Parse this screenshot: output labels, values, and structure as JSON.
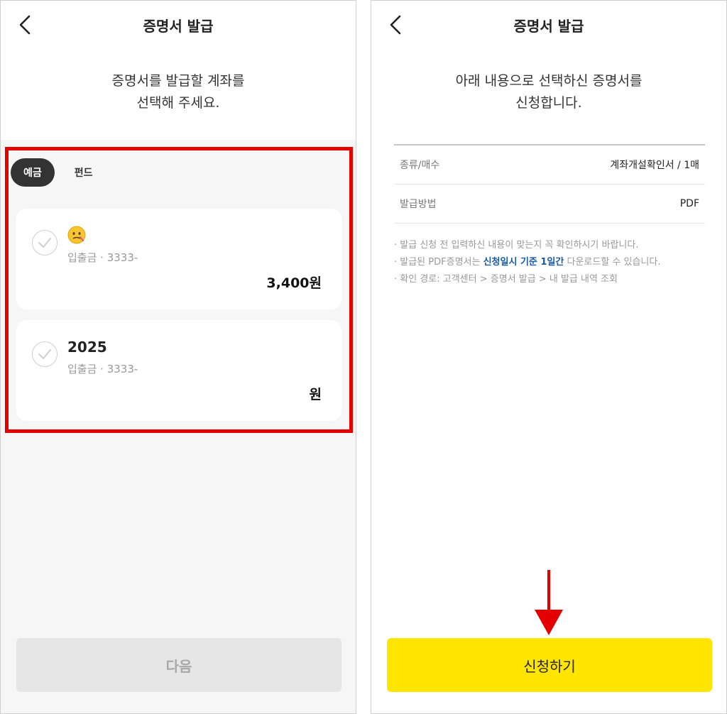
{
  "left": {
    "header": {
      "title": "증명서 발급"
    },
    "intro": {
      "line1": "증명서를 발급할 계좌를",
      "line2": "선택해 주세요."
    },
    "tabs": [
      {
        "label": "예금",
        "active": true
      },
      {
        "label": "펀드",
        "active": false
      }
    ],
    "accounts": [
      {
        "icon": "face-emoji-icon",
        "name": "",
        "type": "입출금 · 3333-",
        "amount": "3,400원"
      },
      {
        "name": "2025",
        "type": "입출금 · 3333-",
        "amount": "원"
      }
    ],
    "next_label": "다음",
    "highlight_color": "#e50000"
  },
  "right": {
    "header": {
      "title": "증명서 발급"
    },
    "intro": {
      "line1": "아래 내용으로 선택하신 증명서를",
      "line2": "신청합니다."
    },
    "summary": [
      {
        "label": "종류/매수",
        "value": "계좌개설확인서 / 1매"
      },
      {
        "label": "발급방법",
        "value": "PDF"
      }
    ],
    "notes": {
      "n1": "· 발급 신청 전 입력하신 내용이 맞는지 꼭 확인하시기 바랍니다.",
      "n2_before": "· 발급된 PDF증명서는 ",
      "n2_highlight": "신청일시 기준 1일간",
      "n2_after": " 다운로드할 수 있습니다.",
      "n3": "· 확인 경로: 고객센터 > 증명서 발급 > 내 발급 내역 조회"
    },
    "apply_label": "신청하기",
    "apply_color": "#ffe500",
    "arrow_color": "#e50000"
  }
}
